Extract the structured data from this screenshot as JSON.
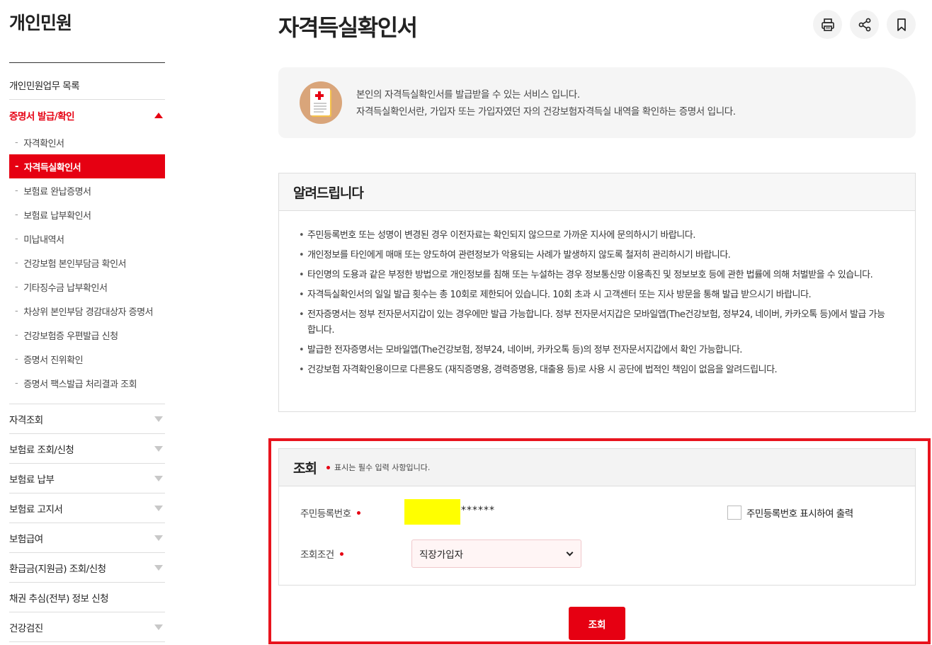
{
  "sidebar": {
    "title": "개인민원",
    "items_top": [
      {
        "label": "개인민원업무 목록"
      },
      {
        "label": "증명서 발급/확인"
      }
    ],
    "sub_items": [
      {
        "label": "자격확인서"
      },
      {
        "label": "자격득실확인서"
      },
      {
        "label": "보험료 완납증명서"
      },
      {
        "label": "보험료 납부확인서"
      },
      {
        "label": "미납내역서"
      },
      {
        "label": "건강보험 본인부담금 확인서"
      },
      {
        "label": "기타징수금 납부확인서"
      },
      {
        "label": "차상위 본인부담 경감대상자 증명서"
      },
      {
        "label": "건강보험증 우편발급 신청"
      },
      {
        "label": "증명서 진위확인"
      },
      {
        "label": "증명서 팩스발급 처리결과 조회"
      }
    ],
    "items_bottom": [
      {
        "label": "자격조회"
      },
      {
        "label": "보험료 조회/신청"
      },
      {
        "label": "보험료 납부"
      },
      {
        "label": "보험료 고지서"
      },
      {
        "label": "보험급여"
      },
      {
        "label": "환급금(지원금) 조회/신청"
      },
      {
        "label": "채권 추심(전부) 정보 신청"
      },
      {
        "label": "건강검진"
      }
    ],
    "dash": "-"
  },
  "main": {
    "title": "자격득실확인서",
    "intro_lines": [
      "본인의 자격득실확인서를 발급받을 수 있는 서비스 입니다.",
      "자격득실확인서란, 가입자 또는 가입자였던 자의 건강보험자격득실 내역을 확인하는 증명서 입니다."
    ],
    "notice_title": "알려드립니다",
    "notices": [
      "주민등록번호 또는 성명이 변경된 경우 이전자료는 확인되지 않으므로 가까운 지사에 문의하시기 바랍니다.",
      "개인정보를 타인에게 매매 또는 양도하여 관련정보가 악용되는 사례가 발생하지 않도록 철저히 관리하시기 바랍니다.",
      "타인명의 도용과 같은 부정한 방법으로 개인정보를 침해 또는 누설하는 경우 정보통신망 이용촉진 및 정보보호 등에 관한 법률에 의해 처벌받을 수 있습니다.",
      "자격득실확인서의 일일 발급 횟수는 총 10회로 제한되어 있습니다. 10회 초과 시 고객센터 또는 지사 방문을 통해 발급 받으시기 바랍니다.",
      "전자증명서는 정부 전자문서지갑이 있는 경우에만 발급 가능합니다. 정부 전자문서지갑은 모바일앱(The건강보험, 정부24, 네이버, 카카오톡 등)에서 발급 가능합니다.",
      "발급한 전자증명서는 모바일앱(The건강보험, 정부24, 네이버, 카카오톡 등)의 정부 전자문서지갑에서 확인 가능합니다.",
      "건강보험 자격확인용이므로 다른용도 (재직증명용, 경력증명용, 대출용 등)로 사용 시 공단에 법적인 책임이 없음을 알려드립니다."
    ],
    "form": {
      "title": "조회",
      "required_note": "표시는 필수 입력 사항입니다.",
      "rrn_label": "주민등록번호",
      "rrn_masked": "******",
      "print_rrn_label": "주민등록번호 표시하여 출력",
      "condition_label": "조회조건",
      "condition_value": "직장가입자",
      "submit_label": "조회"
    }
  },
  "colors": {
    "accent": "#e60012",
    "highlight": "#ffff00",
    "outline": "#e8141e"
  }
}
